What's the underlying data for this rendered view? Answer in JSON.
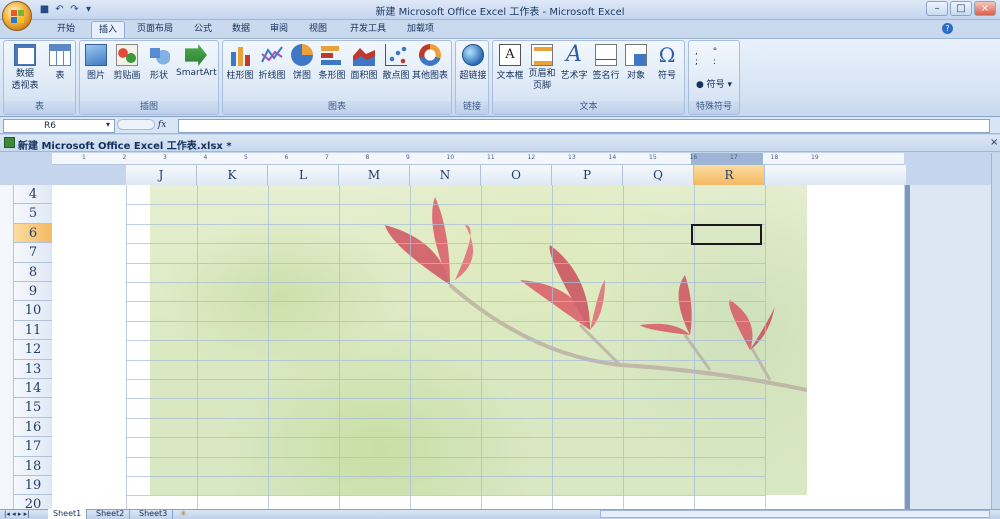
{
  "window": {
    "title": "新建 Microsoft Office Excel 工作表 - Microsoft Excel",
    "minimize": "–",
    "maximize": "□",
    "close": "×"
  },
  "tabs": [
    "开始",
    "插入",
    "页面布局",
    "公式",
    "数据",
    "审阅",
    "视图",
    "开发工具",
    "加载项"
  ],
  "active_tab": "插入",
  "ribbon": {
    "groups": [
      {
        "label": "表",
        "buttons": [
          "数据\n透视表",
          "表"
        ]
      },
      {
        "label": "插图",
        "buttons": [
          "图片",
          "剪贴画",
          "形状",
          "SmartArt"
        ]
      },
      {
        "label": "图表",
        "buttons": [
          "柱形图",
          "折线图",
          "饼图",
          "条形图",
          "面积图",
          "散点图",
          "其他图表"
        ]
      },
      {
        "label": "链接",
        "buttons": [
          "超链接"
        ]
      },
      {
        "label": "文本",
        "buttons": [
          "文本框",
          "页眉和\n页脚",
          "艺术字",
          "签名行",
          "对象",
          "符号"
        ]
      },
      {
        "label": "特殊符号",
        "buttons": [
          "符号"
        ]
      }
    ]
  },
  "name_box": "R6",
  "fx": "fx",
  "workbook_title": "新建 Microsoft Office Excel 工作表.xlsx *",
  "columns": [
    "J",
    "K",
    "L",
    "M",
    "N",
    "O",
    "P",
    "Q",
    "R"
  ],
  "selected_column": "R",
  "rows": [
    "4",
    "5",
    "6",
    "7",
    "8",
    "9",
    "10",
    "11",
    "12",
    "13",
    "14",
    "15",
    "16",
    "17",
    "18",
    "19",
    "20"
  ],
  "selected_row": "6",
  "ruler_numbers": [
    "1",
    "2",
    "3",
    "4",
    "5",
    "6",
    "7",
    "8",
    "9",
    "10",
    "11",
    "12",
    "13",
    "14",
    "15",
    "16",
    "17",
    "18",
    "19"
  ],
  "sheets": [
    "Sheet1",
    "Sheet2",
    "Sheet3"
  ],
  "colors": {
    "ribbon": "#dbe7f6",
    "accent_selected": "#f6c97a",
    "leaf_red": "#d9475b"
  }
}
